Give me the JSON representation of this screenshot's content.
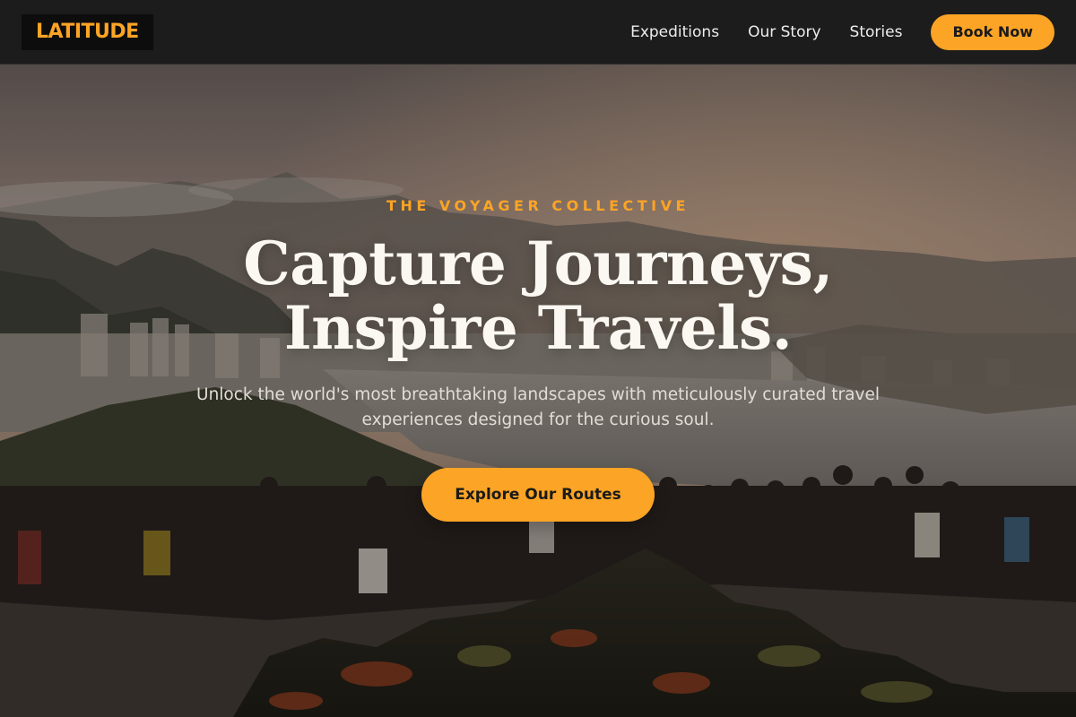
{
  "colors": {
    "accent": "#fca425",
    "navbar_bg": "#1c1c1c",
    "logo_bg": "#0d0d0d"
  },
  "nav": {
    "logo": "LATITUDE",
    "links": [
      "Expeditions",
      "Our Story",
      "Stories"
    ],
    "cta": "Book Now"
  },
  "hero": {
    "eyebrow": "THE VOYAGER COLLECTIVE",
    "headline_line1": "Capture Journeys,",
    "headline_line2": "Inspire Travels.",
    "subtext": "Unlock the world's most breathtaking landscapes with meticulously curated travel experiences designed for the curious soul.",
    "cta": "Explore Our Routes",
    "background_image": "crowd of travelers at mountain viewpoint overlooking city and bay at sunset"
  }
}
